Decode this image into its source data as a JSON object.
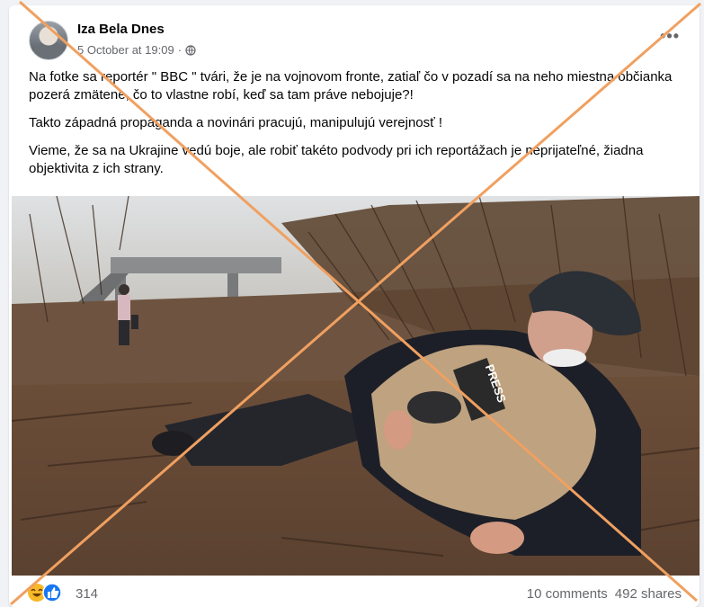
{
  "post": {
    "author": "Iza Bela Dnes",
    "date": "5 October at 19:09",
    "privacy_dot": "·",
    "more_label": "•••",
    "paragraphs": [
      "Na fotke sa reportér \" BBC \" tvári, že je na vojnovom fronte, zatiaľ čo v pozadí sa na neho miestna občianka pozerá zmätene, čo to vlastne robí, keď sa tam práve nebojuje?!",
      "Takto západná propaganda a novinári pracujú, manipulujú verejnosť !",
      "Vieme, že sa na Ukrajine vedú boje, ale robiť takéto  podvody pri ich reportážach je neprijateľné, žiadna objektivita z ich strany."
    ],
    "photo_vest_text": "PRESS"
  },
  "footer": {
    "reaction_count": "314",
    "comments": "10 comments",
    "shares": "492 shares"
  },
  "colors": {
    "cross": "#f0a060",
    "like_blue": "#1877f2",
    "haha_yellow": "#f7b928"
  }
}
